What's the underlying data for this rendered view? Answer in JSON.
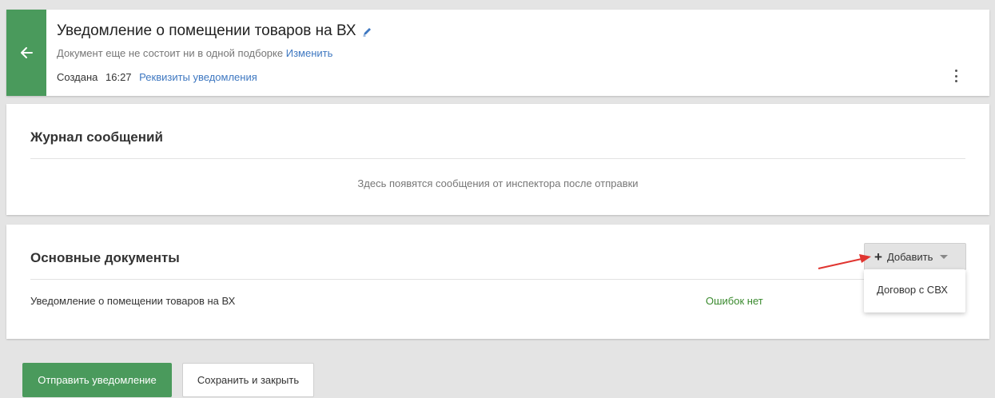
{
  "header": {
    "title": "Уведомление о помещении товаров на ВХ",
    "subtitle": "Документ еще не состоит ни в одной подборке",
    "subtitle_link": "Изменить",
    "created_label": "Создана",
    "created_time": "16:27",
    "details_link": "Реквизиты уведомления",
    "icons": [
      "arrow-left-icon",
      "pencil-icon",
      "more-vertical-icon"
    ]
  },
  "journal": {
    "title": "Журнал сообщений",
    "empty_text": "Здесь появятся сообщения от инспектора после отправки"
  },
  "docs": {
    "title": "Основные документы",
    "add_button": {
      "plus": "+",
      "label": "Добавить"
    },
    "dropdown": {
      "items": [
        "Договор с СВХ"
      ]
    },
    "rows": [
      {
        "name": "Уведомление о помещении товаров на ВХ",
        "status": "Ошибок нет"
      }
    ]
  },
  "footer": {
    "send_label": "Отправить уведомление",
    "save_label": "Сохранить и закрыть"
  },
  "colors": {
    "accent_green": "#4a9a5c",
    "link_blue": "#3f78c1",
    "status_green": "#3a8a2e",
    "annotation_red": "#e03530"
  }
}
